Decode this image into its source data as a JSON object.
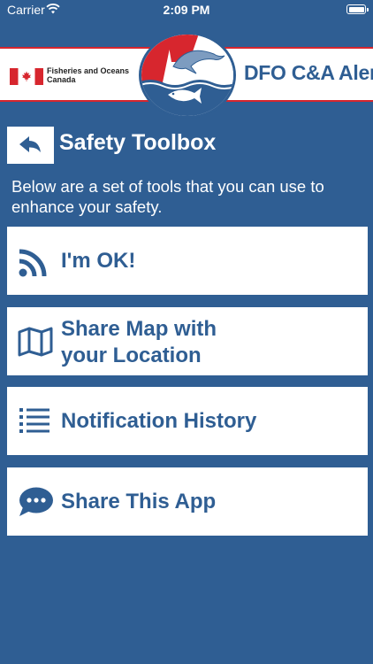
{
  "status_bar": {
    "carrier": "Carrier",
    "time": "2:09 PM"
  },
  "header": {
    "department_line1": "Fisheries and Oceans",
    "department_line2": "Canada",
    "app_title": "DFO C&A Alert"
  },
  "page": {
    "title": "Safety Toolbox",
    "intro": "Below are a set of tools that you can use to enhance your safety."
  },
  "tools": [
    {
      "label": "I'm OK!",
      "icon": "rss-icon"
    },
    {
      "label_line1": "Share Map with",
      "label_line2": "your Location",
      "icon": "map-icon"
    },
    {
      "label": "Notification History",
      "icon": "list-icon"
    },
    {
      "label": "Share This App",
      "icon": "chat-bubble-icon"
    }
  ],
  "colors": {
    "background": "#2f5e93",
    "accent_red": "#d7262e",
    "card": "#ffffff",
    "text_blue": "#2f5e93"
  }
}
